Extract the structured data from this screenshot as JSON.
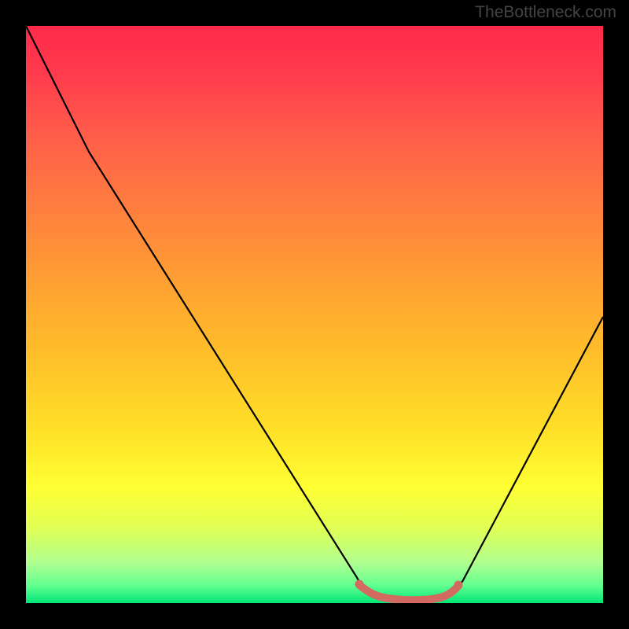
{
  "watermark": "TheBottleneck.com",
  "chart_data": {
    "type": "line",
    "title": "",
    "xlabel": "",
    "ylabel": "",
    "xlim": [
      0,
      100
    ],
    "ylim": [
      0,
      100
    ],
    "series": [
      {
        "name": "bottleneck-curve",
        "x": [
          0,
          5,
          10,
          15,
          20,
          25,
          30,
          35,
          40,
          45,
          50,
          55,
          58,
          60,
          63,
          66,
          69,
          72,
          75,
          80,
          85,
          90,
          95,
          100
        ],
        "y": [
          100,
          92,
          83,
          75,
          66,
          58,
          49,
          41,
          32,
          24,
          15,
          7,
          3,
          1,
          0,
          0,
          0,
          0,
          1,
          8,
          18,
          29,
          40,
          52
        ]
      },
      {
        "name": "optimal-region-marker",
        "x": [
          58,
          60,
          62,
          64,
          66,
          68,
          70,
          72
        ],
        "y": [
          2.5,
          1.8,
          1.5,
          1.3,
          1.3,
          1.5,
          1.8,
          2.5
        ]
      }
    ],
    "colors": {
      "curve": "#000000",
      "marker": "#d36a62",
      "gradient_top": "#ff2a4a",
      "gradient_mid": "#ffe028",
      "gradient_bottom": "#00e676"
    }
  }
}
